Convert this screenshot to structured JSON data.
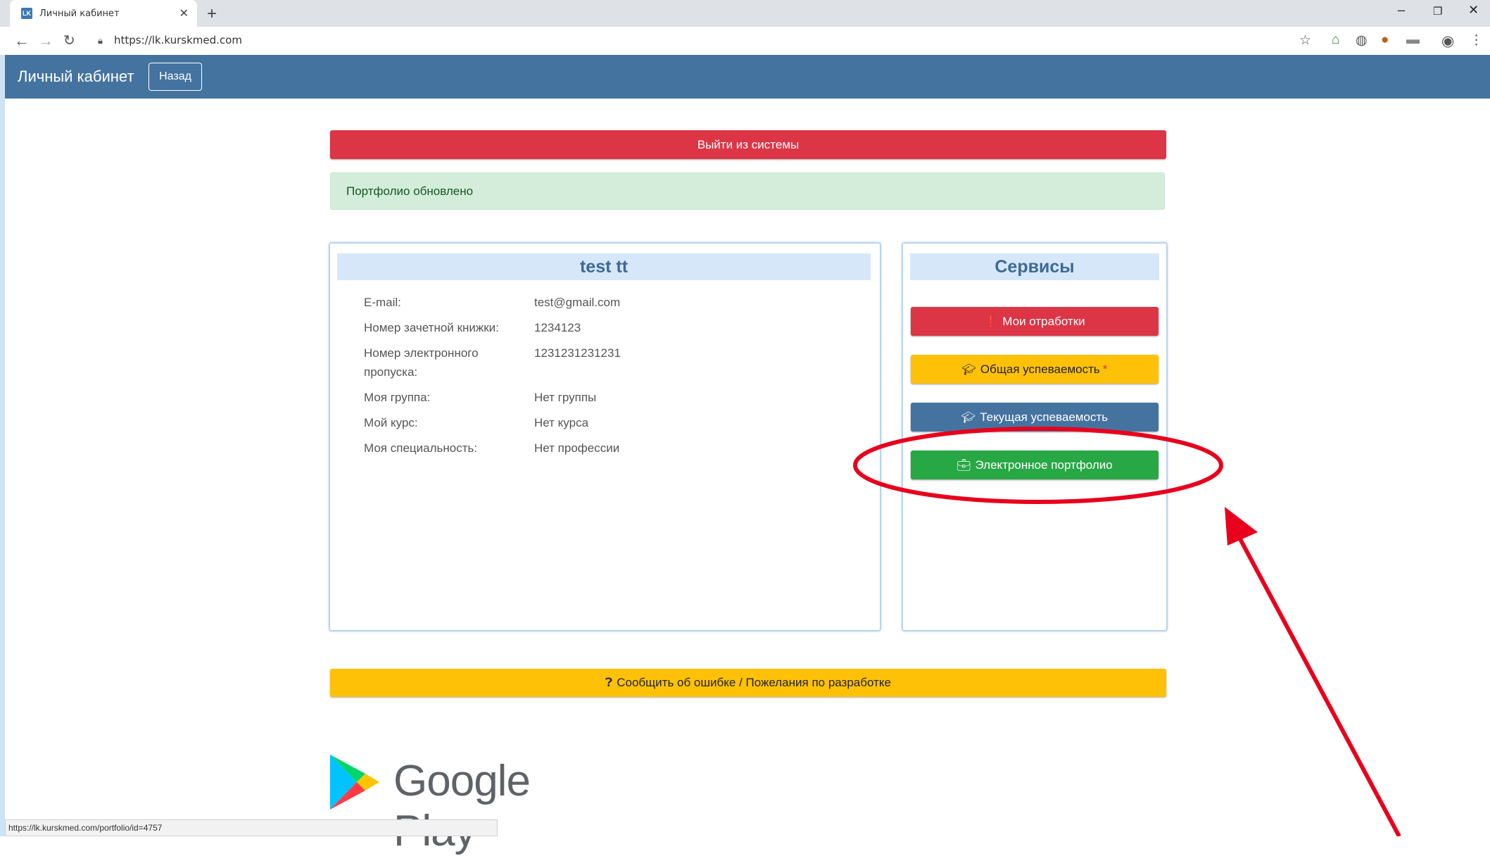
{
  "browser": {
    "tab_title": "Личный кабинет",
    "tab_icon": "LK",
    "new_tab": "+",
    "url": "https://lk.kurskmed.com",
    "status_url": "https://lk.kurskmed.com/portfolio/id=4757"
  },
  "navbar": {
    "brand": "Личный кабинет",
    "back_label": "Назад"
  },
  "logout_label": "Выйти из системы",
  "alert_text": "Портфолио обновлено",
  "profile": {
    "name": "test tt",
    "fields": [
      {
        "label": "E-mail:",
        "value": "test@gmail.com"
      },
      {
        "label": "Номер зачетной книжки:",
        "value": "1234123"
      },
      {
        "label": "Номер электронного пропуска:",
        "value": "1231231231231"
      },
      {
        "label": "Моя группа:",
        "value": "Нет группы"
      },
      {
        "label": "Мой курс:",
        "value": "Нет курса"
      },
      {
        "label": "Моя специальность:",
        "value": "Нет профессии"
      }
    ]
  },
  "services": {
    "title": "Сервисы",
    "buttons": [
      {
        "label": "Мои отработки",
        "icon": "exclamation-circle-icon",
        "color": "#dc3545"
      },
      {
        "label": "Общая успеваемость",
        "marker": "*",
        "icon": "graduation-cap-icon",
        "color": "#ffc107"
      },
      {
        "label": "Текущая успеваемость",
        "icon": "graduation-cap-icon",
        "color": "#4473a0"
      },
      {
        "label": "Электронное портфолио",
        "icon": "briefcase-icon",
        "color": "#28a745"
      }
    ]
  },
  "report_label": "Сообщить об ошибке / Пожелания по разработке",
  "store_badge": "Google Play",
  "colors": {
    "navbar": "#4473a0",
    "danger": "#dc3545",
    "warning": "#ffc107",
    "success": "#28a745",
    "annotation": "#e8001c"
  }
}
